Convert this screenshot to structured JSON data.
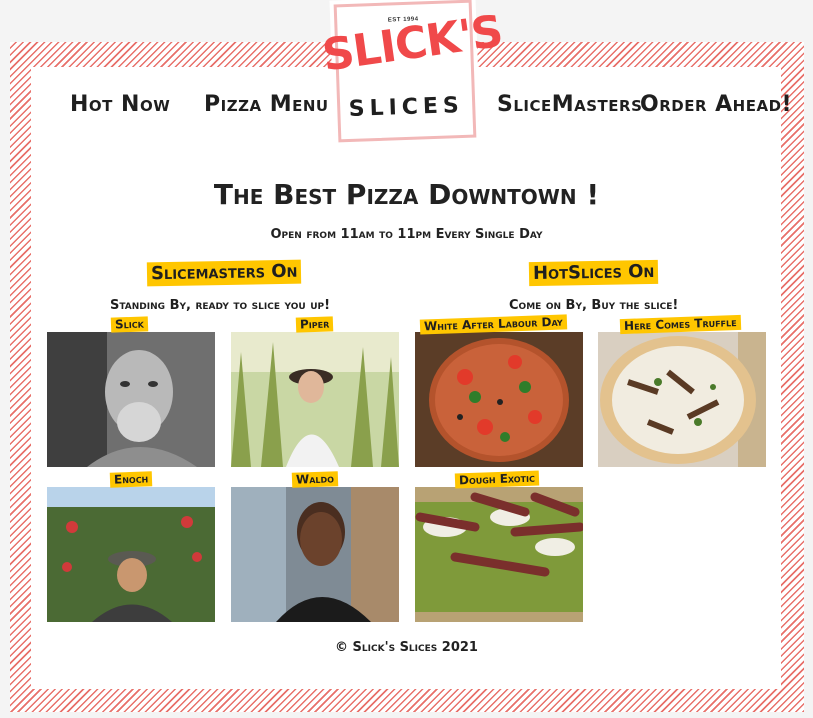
{
  "logo": {
    "est": "EST 1994",
    "top": "SLICK'S",
    "bottom": "SLICES"
  },
  "nav": {
    "hot_now": "Hot Now",
    "pizza_menu": "Pizza Menu",
    "slicemasters": "SliceMasters",
    "order_ahead": "Order Ahead!"
  },
  "hero": {
    "title": "The Best Pizza Downtown !",
    "hours": "Open from 11am to 11pm Every Single Day"
  },
  "slicemasters": {
    "title": "Slicemasters On",
    "subtitle": "Standing By, ready to slice you up!",
    "people": [
      {
        "name": "Slick",
        "icon": "person-photo"
      },
      {
        "name": "Piper",
        "icon": "person-photo"
      },
      {
        "name": "Enoch",
        "icon": "person-photo"
      },
      {
        "name": "Waldo",
        "icon": "person-photo"
      }
    ]
  },
  "hotslices": {
    "title": "HotSlices On",
    "subtitle": "Come on By, Buy the slice!",
    "pizzas": [
      {
        "name": "White After Labour Day",
        "icon": "pizza-photo"
      },
      {
        "name": "Here Comes Truffle",
        "icon": "pizza-photo"
      },
      {
        "name": "Dough Exotic",
        "icon": "pizza-photo"
      }
    ]
  },
  "footer": {
    "text": "© Slick's Slices 2021"
  },
  "colors": {
    "accent": "#ffc600",
    "brand": "#f0494a",
    "stripe": "#e8706a"
  }
}
